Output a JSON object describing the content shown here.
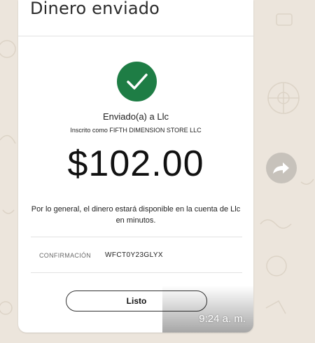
{
  "card": {
    "title": "Dinero enviado",
    "recipient_line": "Enviado(a) a Llc",
    "registered_line": "Inscrito como FIFTH DIMENSION STORE LLC",
    "amount": "$102.00",
    "availability_notice": "Por lo general, el dinero estará disponible en la cuenta de Llc en minutos.",
    "confirmation": {
      "label": "CONFIRMACIÓN",
      "value": "WFCT0Y23GLYX"
    },
    "done_button": "Listo"
  },
  "message": {
    "time": "9:24 a. m."
  },
  "icons": {
    "status": "check-circle-icon",
    "forward": "forward-icon"
  },
  "colors": {
    "success_green": "#1e7d45",
    "chat_background": "#ece5dc"
  }
}
